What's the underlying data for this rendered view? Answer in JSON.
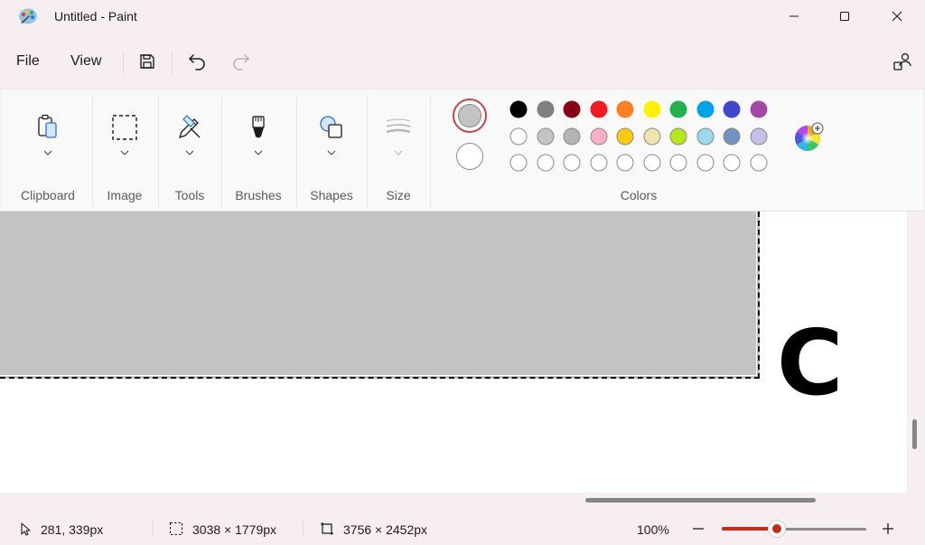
{
  "window": {
    "title": "Untitled - Paint"
  },
  "window_controls": {
    "minimize_icon": "minimize-icon",
    "maximize_icon": "maximize-icon",
    "close_icon": "close-icon"
  },
  "menu": {
    "file": "File",
    "view": "View"
  },
  "quick_access": {
    "save_icon": "save-icon",
    "undo_icon": "undo-icon",
    "redo_icon": "redo-icon",
    "account_icon": "account-icon"
  },
  "ribbon": {
    "groups": {
      "clipboard": "Clipboard",
      "image": "Image",
      "tools": "Tools",
      "brushes": "Brushes",
      "shapes": "Shapes",
      "size": "Size",
      "colors": "Colors"
    }
  },
  "colors": {
    "primary": "#c3c3c3",
    "secondary": "#ffffff",
    "accent": "#c42b1c",
    "palette_row1": [
      "#000000",
      "#7f7f7f",
      "#880015",
      "#ed1c24",
      "#ff7f27",
      "#fff200",
      "#22b14c",
      "#00a2e8",
      "#3f48cc",
      "#a349a4"
    ],
    "palette_row2": [
      "#ffffff",
      "#c3c3c3",
      "#b4b4b4",
      "#ffaec9",
      "#ffc90e",
      "#efe4b0",
      "#b5e61d",
      "#99d9ea",
      "#7092be",
      "#c8bfe7"
    ],
    "palette_row3": [
      "",
      "",
      "",
      "",
      "",
      "",
      "",
      "",
      "",
      ""
    ]
  },
  "canvas": {
    "letter": "C",
    "selection_fill": "#c3c3c3"
  },
  "status": {
    "cursor": "281, 339px",
    "selection_size": "3038 × 1779px",
    "canvas_size": "3756 × 2452px",
    "zoom": "100%",
    "zoom_level": 0.38
  }
}
